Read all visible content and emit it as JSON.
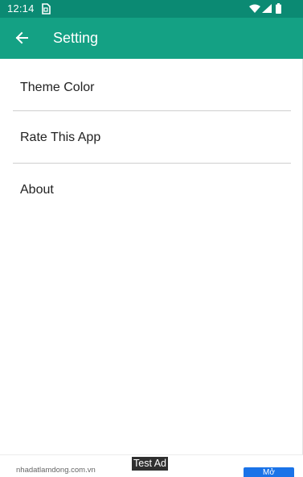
{
  "status_bar": {
    "time": "12:14",
    "icons": [
      "sim-icon",
      "wifi-icon",
      "signal-icon",
      "battery-icon"
    ]
  },
  "app_bar": {
    "back_icon": "arrow-left-icon",
    "title": "Setting"
  },
  "settings": {
    "items": [
      {
        "label": "Theme Color"
      },
      {
        "label": "Rate This App"
      },
      {
        "label": "About"
      }
    ]
  },
  "ad": {
    "domain": "nhadatlamdong.com.vn",
    "test_label": "Test Ad",
    "cta_label": "Mở"
  },
  "colors": {
    "status_bar": "#0b8a73",
    "app_bar": "#14a184",
    "ad_button": "#1a73e8"
  }
}
